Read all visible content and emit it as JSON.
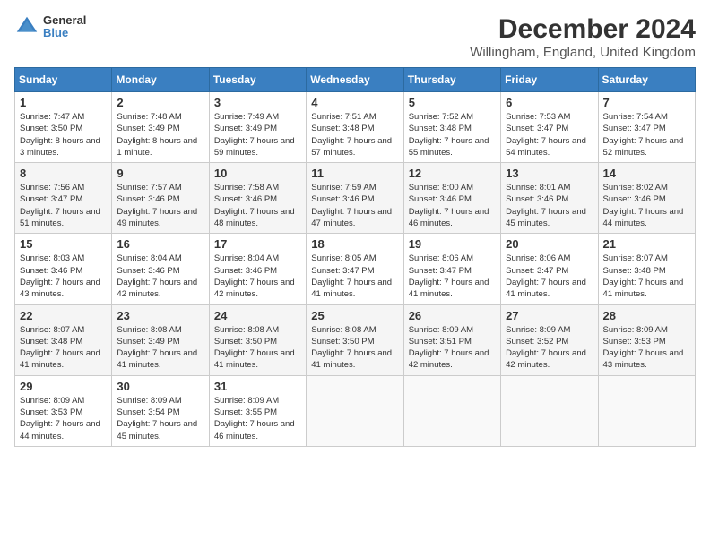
{
  "logo": {
    "general": "General",
    "blue": "Blue"
  },
  "title": "December 2024",
  "subtitle": "Willingham, England, United Kingdom",
  "weekdays": [
    "Sunday",
    "Monday",
    "Tuesday",
    "Wednesday",
    "Thursday",
    "Friday",
    "Saturday"
  ],
  "weeks": [
    [
      {
        "day": "1",
        "sunrise": "7:47 AM",
        "sunset": "3:50 PM",
        "daylight": "8 hours and 3 minutes."
      },
      {
        "day": "2",
        "sunrise": "7:48 AM",
        "sunset": "3:49 PM",
        "daylight": "8 hours and 1 minute."
      },
      {
        "day": "3",
        "sunrise": "7:49 AM",
        "sunset": "3:49 PM",
        "daylight": "7 hours and 59 minutes."
      },
      {
        "day": "4",
        "sunrise": "7:51 AM",
        "sunset": "3:48 PM",
        "daylight": "7 hours and 57 minutes."
      },
      {
        "day": "5",
        "sunrise": "7:52 AM",
        "sunset": "3:48 PM",
        "daylight": "7 hours and 55 minutes."
      },
      {
        "day": "6",
        "sunrise": "7:53 AM",
        "sunset": "3:47 PM",
        "daylight": "7 hours and 54 minutes."
      },
      {
        "day": "7",
        "sunrise": "7:54 AM",
        "sunset": "3:47 PM",
        "daylight": "7 hours and 52 minutes."
      }
    ],
    [
      {
        "day": "8",
        "sunrise": "7:56 AM",
        "sunset": "3:47 PM",
        "daylight": "7 hours and 51 minutes."
      },
      {
        "day": "9",
        "sunrise": "7:57 AM",
        "sunset": "3:46 PM",
        "daylight": "7 hours and 49 minutes."
      },
      {
        "day": "10",
        "sunrise": "7:58 AM",
        "sunset": "3:46 PM",
        "daylight": "7 hours and 48 minutes."
      },
      {
        "day": "11",
        "sunrise": "7:59 AM",
        "sunset": "3:46 PM",
        "daylight": "7 hours and 47 minutes."
      },
      {
        "day": "12",
        "sunrise": "8:00 AM",
        "sunset": "3:46 PM",
        "daylight": "7 hours and 46 minutes."
      },
      {
        "day": "13",
        "sunrise": "8:01 AM",
        "sunset": "3:46 PM",
        "daylight": "7 hours and 45 minutes."
      },
      {
        "day": "14",
        "sunrise": "8:02 AM",
        "sunset": "3:46 PM",
        "daylight": "7 hours and 44 minutes."
      }
    ],
    [
      {
        "day": "15",
        "sunrise": "8:03 AM",
        "sunset": "3:46 PM",
        "daylight": "7 hours and 43 minutes."
      },
      {
        "day": "16",
        "sunrise": "8:04 AM",
        "sunset": "3:46 PM",
        "daylight": "7 hours and 42 minutes."
      },
      {
        "day": "17",
        "sunrise": "8:04 AM",
        "sunset": "3:46 PM",
        "daylight": "7 hours and 42 minutes."
      },
      {
        "day": "18",
        "sunrise": "8:05 AM",
        "sunset": "3:47 PM",
        "daylight": "7 hours and 41 minutes."
      },
      {
        "day": "19",
        "sunrise": "8:06 AM",
        "sunset": "3:47 PM",
        "daylight": "7 hours and 41 minutes."
      },
      {
        "day": "20",
        "sunrise": "8:06 AM",
        "sunset": "3:47 PM",
        "daylight": "7 hours and 41 minutes."
      },
      {
        "day": "21",
        "sunrise": "8:07 AM",
        "sunset": "3:48 PM",
        "daylight": "7 hours and 41 minutes."
      }
    ],
    [
      {
        "day": "22",
        "sunrise": "8:07 AM",
        "sunset": "3:48 PM",
        "daylight": "7 hours and 41 minutes."
      },
      {
        "day": "23",
        "sunrise": "8:08 AM",
        "sunset": "3:49 PM",
        "daylight": "7 hours and 41 minutes."
      },
      {
        "day": "24",
        "sunrise": "8:08 AM",
        "sunset": "3:50 PM",
        "daylight": "7 hours and 41 minutes."
      },
      {
        "day": "25",
        "sunrise": "8:08 AM",
        "sunset": "3:50 PM",
        "daylight": "7 hours and 41 minutes."
      },
      {
        "day": "26",
        "sunrise": "8:09 AM",
        "sunset": "3:51 PM",
        "daylight": "7 hours and 42 minutes."
      },
      {
        "day": "27",
        "sunrise": "8:09 AM",
        "sunset": "3:52 PM",
        "daylight": "7 hours and 42 minutes."
      },
      {
        "day": "28",
        "sunrise": "8:09 AM",
        "sunset": "3:53 PM",
        "daylight": "7 hours and 43 minutes."
      }
    ],
    [
      {
        "day": "29",
        "sunrise": "8:09 AM",
        "sunset": "3:53 PM",
        "daylight": "7 hours and 44 minutes."
      },
      {
        "day": "30",
        "sunrise": "8:09 AM",
        "sunset": "3:54 PM",
        "daylight": "7 hours and 45 minutes."
      },
      {
        "day": "31",
        "sunrise": "8:09 AM",
        "sunset": "3:55 PM",
        "daylight": "7 hours and 46 minutes."
      },
      null,
      null,
      null,
      null
    ]
  ]
}
